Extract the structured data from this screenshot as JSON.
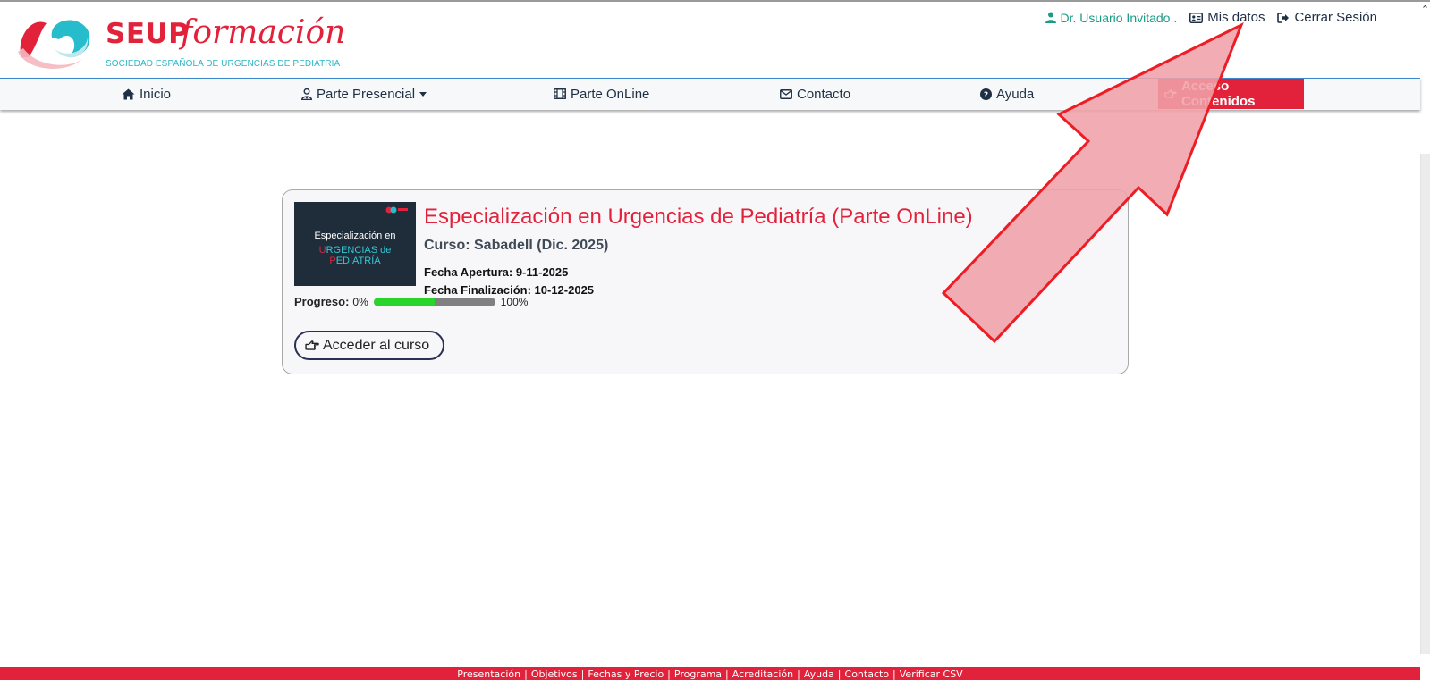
{
  "header": {
    "logo": {
      "brand": "SEUP",
      "script": "formación",
      "subtitle": "SOCIEDAD ESPAÑOLA DE URGENCIAS DE PEDIATRIA"
    },
    "user": {
      "name": "Dr. Usuario Invitado .",
      "my_data": "Mis datos",
      "logout": "Cerrar Sesión"
    }
  },
  "nav": {
    "items": [
      {
        "label": "Inicio",
        "icon": "home-icon"
      },
      {
        "label": "Parte Presencial",
        "icon": "user-md-icon"
      },
      {
        "label": "Parte OnLine",
        "icon": "film-icon"
      },
      {
        "label": "Contacto",
        "icon": "envelope-icon"
      },
      {
        "label": "Ayuda",
        "icon": "question-circle-icon"
      },
      {
        "label": "Acceso Contenidos",
        "icon": "hand-pointer-icon"
      }
    ]
  },
  "course": {
    "thumb_line1": "Especialización en",
    "thumb_line2a": "U",
    "thumb_line2b": "RGENCIAS de ",
    "thumb_line2c": "P",
    "thumb_line2d": "EDIATRÍA",
    "title": "Especialización en Urgencias de Pediatría (Parte OnLine)",
    "curso": "Curso: Sabadell (Dic. 2025)",
    "fecha_apertura": "Fecha Apertura: 9-11-2025",
    "fecha_finalizacion": "Fecha Finalización: 10-12-2025",
    "progress_label": "Progreso:",
    "progress_min": "0%",
    "progress_max": "100%",
    "progress_value": 0.5,
    "button": "Acceder al curso"
  },
  "footer": {
    "links": [
      "Presentación",
      "Objetivos",
      "Fechas y Precio",
      "Programa",
      "Acreditación",
      "Ayuda",
      "Contacto",
      "Verificar CSV"
    ]
  },
  "colors": {
    "brand_red": "#e2223b",
    "teal": "#1a9b88",
    "progress_green": "#2bd42b",
    "arrow_fill": "#f0a0a8",
    "arrow_stroke": "#ee1c25"
  }
}
